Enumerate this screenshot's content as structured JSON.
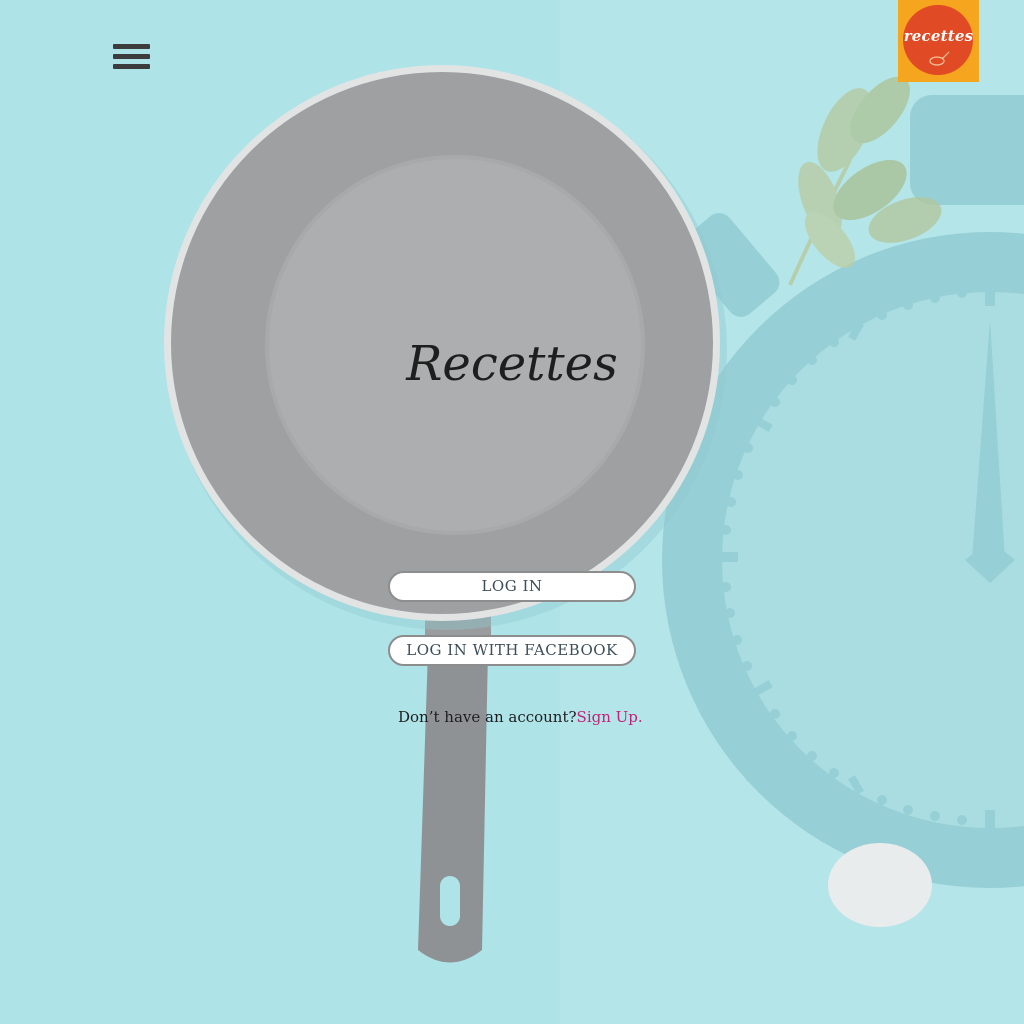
{
  "app": {
    "title": "Recettes",
    "logo_text": "recettes"
  },
  "header": {
    "menu_icon": "hamburger-menu-icon"
  },
  "actions": {
    "login_label": "LOG IN",
    "facebook_login_label": "LOG IN WITH FACEBOOK"
  },
  "signup": {
    "prompt": "Don’t have an account?",
    "link_label": "Sign Up."
  },
  "colors": {
    "background": "#aee3e8",
    "logo_background": "#f6a51e",
    "logo_circle": "#e04a25",
    "signup_link": "#c2217a",
    "button_text": "#3d4e5a"
  }
}
